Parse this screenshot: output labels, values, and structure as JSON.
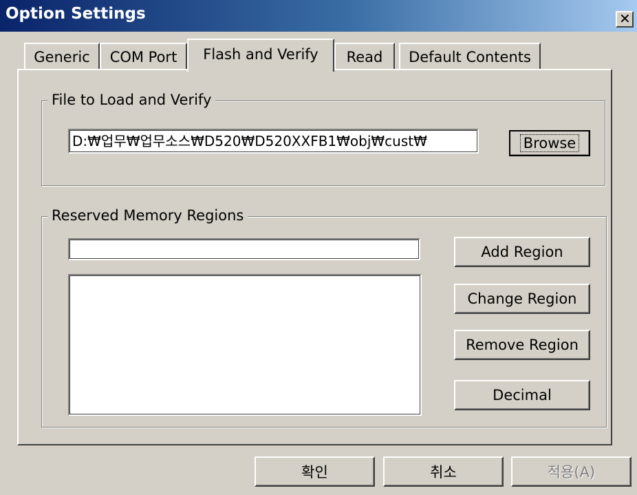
{
  "window": {
    "title": "Option Settings",
    "close_symbol": "✕",
    "close_icon": "close-icon"
  },
  "tabs": [
    {
      "label": "Generic",
      "active": false
    },
    {
      "label": "COM Port",
      "active": false
    },
    {
      "label": "Flash and Verify",
      "active": true
    },
    {
      "label": "Read",
      "active": false
    },
    {
      "label": "Default Contents",
      "active": false
    }
  ],
  "file_group": {
    "title": "File to Load and Verify",
    "path_value": "D:₩업무₩업무소스₩D520₩D520XXFB1₩obj₩cust₩",
    "browse_label": "Browse"
  },
  "reserved_group": {
    "title": "Reserved Memory Regions",
    "region_input_value": "",
    "regions_list": [],
    "add_label": "Add Region",
    "change_label": "Change Region",
    "remove_label": "Remove Region",
    "decimal_label": "Decimal"
  },
  "footer": {
    "ok_label": "확인",
    "cancel_label": "취소",
    "apply_label": "적용(A)"
  }
}
